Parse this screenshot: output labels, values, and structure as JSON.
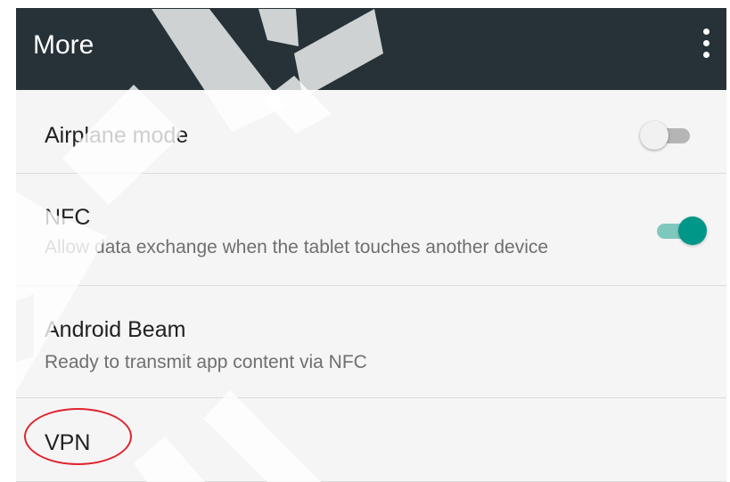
{
  "appbar": {
    "title": "More",
    "overflow_icon": "more-vert-icon"
  },
  "settings": {
    "items": [
      {
        "title": "Airplane mode",
        "summary": "",
        "toggle": "off"
      },
      {
        "title": "NFC",
        "summary": "Allow data exchange when the tablet touches another device",
        "toggle": "on"
      },
      {
        "title": "Android Beam",
        "summary": "Ready to transmit app content via NFC"
      },
      {
        "title": "VPN",
        "summary": ""
      }
    ]
  },
  "annotation": {
    "highlight_target": "VPN",
    "highlight_color": "#e0242e"
  },
  "colors": {
    "appbar": "#263238",
    "switch_on": "#009688",
    "background": "#f5f5f5"
  }
}
